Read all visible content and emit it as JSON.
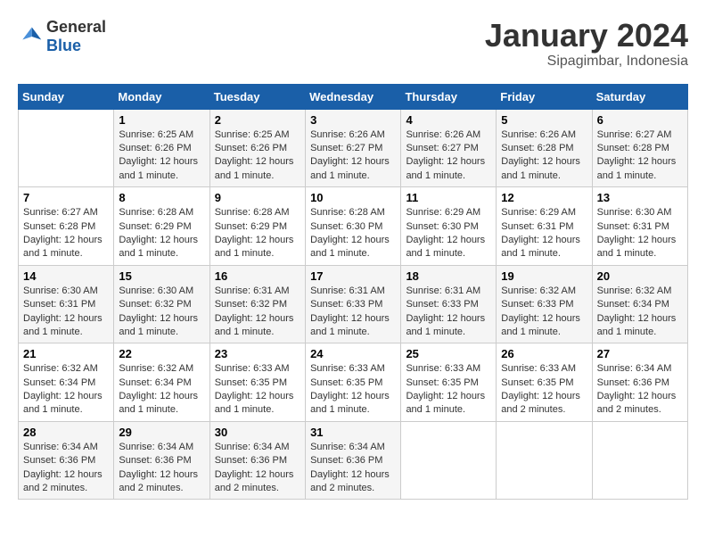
{
  "header": {
    "logo_general": "General",
    "logo_blue": "Blue",
    "month_year": "January 2024",
    "location": "Sipagimbar, Indonesia"
  },
  "days_of_week": [
    "Sunday",
    "Monday",
    "Tuesday",
    "Wednesday",
    "Thursday",
    "Friday",
    "Saturday"
  ],
  "weeks": [
    [
      {
        "day": "",
        "sunrise": "",
        "sunset": "",
        "daylight": ""
      },
      {
        "day": "1",
        "sunrise": "6:25 AM",
        "sunset": "6:26 PM",
        "daylight": "12 hours and 1 minute."
      },
      {
        "day": "2",
        "sunrise": "6:25 AM",
        "sunset": "6:26 PM",
        "daylight": "12 hours and 1 minute."
      },
      {
        "day": "3",
        "sunrise": "6:26 AM",
        "sunset": "6:27 PM",
        "daylight": "12 hours and 1 minute."
      },
      {
        "day": "4",
        "sunrise": "6:26 AM",
        "sunset": "6:27 PM",
        "daylight": "12 hours and 1 minute."
      },
      {
        "day": "5",
        "sunrise": "6:26 AM",
        "sunset": "6:28 PM",
        "daylight": "12 hours and 1 minute."
      },
      {
        "day": "6",
        "sunrise": "6:27 AM",
        "sunset": "6:28 PM",
        "daylight": "12 hours and 1 minute."
      }
    ],
    [
      {
        "day": "7",
        "sunrise": "6:27 AM",
        "sunset": "6:28 PM",
        "daylight": "12 hours and 1 minute."
      },
      {
        "day": "8",
        "sunrise": "6:28 AM",
        "sunset": "6:29 PM",
        "daylight": "12 hours and 1 minute."
      },
      {
        "day": "9",
        "sunrise": "6:28 AM",
        "sunset": "6:29 PM",
        "daylight": "12 hours and 1 minute."
      },
      {
        "day": "10",
        "sunrise": "6:28 AM",
        "sunset": "6:30 PM",
        "daylight": "12 hours and 1 minute."
      },
      {
        "day": "11",
        "sunrise": "6:29 AM",
        "sunset": "6:30 PM",
        "daylight": "12 hours and 1 minute."
      },
      {
        "day": "12",
        "sunrise": "6:29 AM",
        "sunset": "6:31 PM",
        "daylight": "12 hours and 1 minute."
      },
      {
        "day": "13",
        "sunrise": "6:30 AM",
        "sunset": "6:31 PM",
        "daylight": "12 hours and 1 minute."
      }
    ],
    [
      {
        "day": "14",
        "sunrise": "6:30 AM",
        "sunset": "6:31 PM",
        "daylight": "12 hours and 1 minute."
      },
      {
        "day": "15",
        "sunrise": "6:30 AM",
        "sunset": "6:32 PM",
        "daylight": "12 hours and 1 minute."
      },
      {
        "day": "16",
        "sunrise": "6:31 AM",
        "sunset": "6:32 PM",
        "daylight": "12 hours and 1 minute."
      },
      {
        "day": "17",
        "sunrise": "6:31 AM",
        "sunset": "6:33 PM",
        "daylight": "12 hours and 1 minute."
      },
      {
        "day": "18",
        "sunrise": "6:31 AM",
        "sunset": "6:33 PM",
        "daylight": "12 hours and 1 minute."
      },
      {
        "day": "19",
        "sunrise": "6:32 AM",
        "sunset": "6:33 PM",
        "daylight": "12 hours and 1 minute."
      },
      {
        "day": "20",
        "sunrise": "6:32 AM",
        "sunset": "6:34 PM",
        "daylight": "12 hours and 1 minute."
      }
    ],
    [
      {
        "day": "21",
        "sunrise": "6:32 AM",
        "sunset": "6:34 PM",
        "daylight": "12 hours and 1 minute."
      },
      {
        "day": "22",
        "sunrise": "6:32 AM",
        "sunset": "6:34 PM",
        "daylight": "12 hours and 1 minute."
      },
      {
        "day": "23",
        "sunrise": "6:33 AM",
        "sunset": "6:35 PM",
        "daylight": "12 hours and 1 minute."
      },
      {
        "day": "24",
        "sunrise": "6:33 AM",
        "sunset": "6:35 PM",
        "daylight": "12 hours and 1 minute."
      },
      {
        "day": "25",
        "sunrise": "6:33 AM",
        "sunset": "6:35 PM",
        "daylight": "12 hours and 1 minute."
      },
      {
        "day": "26",
        "sunrise": "6:33 AM",
        "sunset": "6:35 PM",
        "daylight": "12 hours and 2 minutes."
      },
      {
        "day": "27",
        "sunrise": "6:34 AM",
        "sunset": "6:36 PM",
        "daylight": "12 hours and 2 minutes."
      }
    ],
    [
      {
        "day": "28",
        "sunrise": "6:34 AM",
        "sunset": "6:36 PM",
        "daylight": "12 hours and 2 minutes."
      },
      {
        "day": "29",
        "sunrise": "6:34 AM",
        "sunset": "6:36 PM",
        "daylight": "12 hours and 2 minutes."
      },
      {
        "day": "30",
        "sunrise": "6:34 AM",
        "sunset": "6:36 PM",
        "daylight": "12 hours and 2 minutes."
      },
      {
        "day": "31",
        "sunrise": "6:34 AM",
        "sunset": "6:36 PM",
        "daylight": "12 hours and 2 minutes."
      },
      {
        "day": "",
        "sunrise": "",
        "sunset": "",
        "daylight": ""
      },
      {
        "day": "",
        "sunrise": "",
        "sunset": "",
        "daylight": ""
      },
      {
        "day": "",
        "sunrise": "",
        "sunset": "",
        "daylight": ""
      }
    ]
  ],
  "labels": {
    "sunrise_prefix": "Sunrise: ",
    "sunset_prefix": "Sunset: ",
    "daylight_prefix": "Daylight: "
  }
}
